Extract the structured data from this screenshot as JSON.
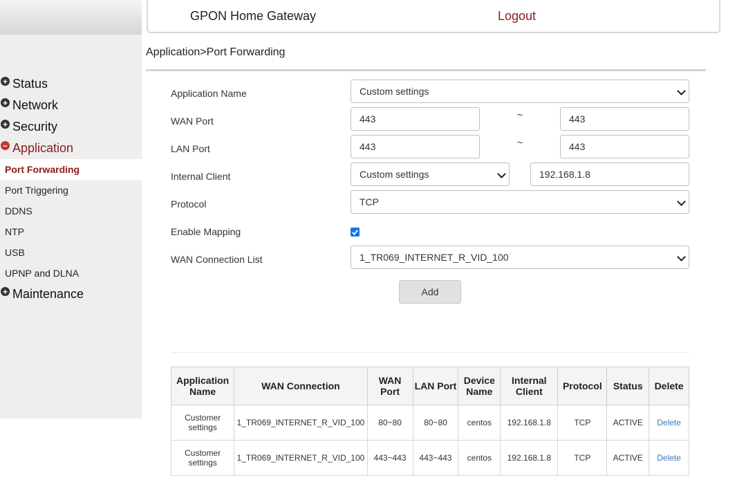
{
  "header": {
    "title": "GPON Home Gateway",
    "logout": "Logout"
  },
  "breadcrumb": "Application>Port Forwarding",
  "sidebar": {
    "groups": [
      {
        "label": "Status",
        "expanded": false
      },
      {
        "label": "Network",
        "expanded": false
      },
      {
        "label": "Security",
        "expanded": false
      },
      {
        "label": "Application",
        "expanded": true
      },
      {
        "label": "Maintenance",
        "expanded": false
      }
    ],
    "app_items": [
      "Port Forwarding",
      "Port Triggering",
      "DDNS",
      "NTP",
      "USB",
      "UPNP and DLNA"
    ],
    "current": "Port Forwarding",
    "plus": "+",
    "minus": "−"
  },
  "form": {
    "app_name_label": "Application Name",
    "app_name_value": "Custom settings",
    "wan_port_label": "WAN Port",
    "wan_port_start": "443",
    "wan_port_end": "443",
    "lan_port_label": "LAN Port",
    "lan_port_start": "443",
    "lan_port_end": "443",
    "tilde": "~",
    "internal_client_label": "Internal Client",
    "internal_client_select": "Custom settings",
    "internal_client_ip": "192.168.1.8",
    "protocol_label": "Protocol",
    "protocol_value": "TCP",
    "enable_mapping_label": "Enable Mapping",
    "enable_mapping_checked": true,
    "wan_conn_label": "WAN Connection List",
    "wan_conn_value": "1_TR069_INTERNET_R_VID_100",
    "add_button": "Add"
  },
  "table": {
    "headers": [
      "Application Name",
      "WAN Connection",
      "WAN Port",
      "LAN Port",
      "Device Name",
      "Internal Client",
      "Protocol",
      "Status",
      "Delete"
    ],
    "rows": [
      [
        "Customer settings",
        "1_TR069_INTERNET_R_VID_100",
        "80~80",
        "80~80",
        "centos",
        "192.168.1.8",
        "TCP",
        "ACTIVE",
        "Delete"
      ],
      [
        "Customer settings",
        "1_TR069_INTERNET_R_VID_100",
        "443~443",
        "443~443",
        "centos",
        "192.168.1.8",
        "TCP",
        "ACTIVE",
        "Delete"
      ]
    ]
  },
  "colors": {
    "accent": "#8b1a1a",
    "link": "#3a76b8",
    "checkbox": "#1a73e8"
  }
}
